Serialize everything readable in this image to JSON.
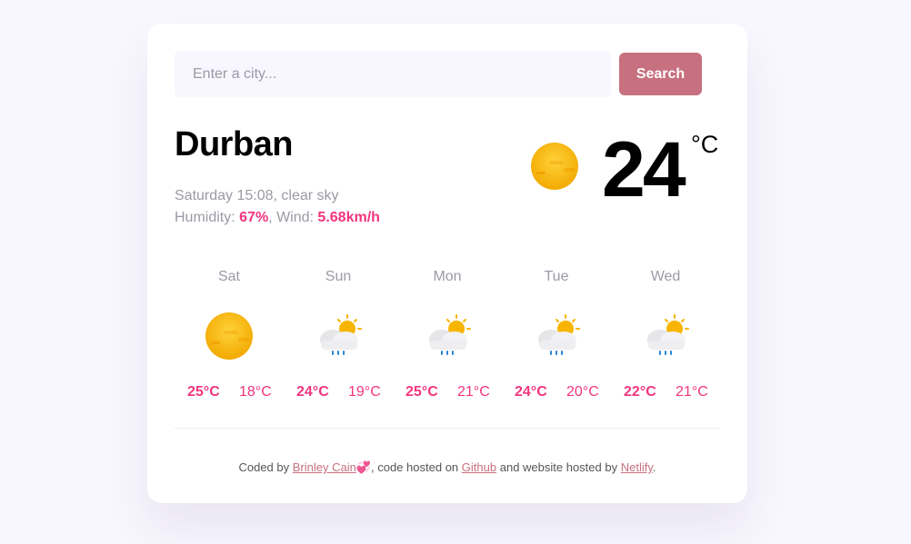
{
  "search": {
    "placeholder": "Enter a city...",
    "value": "",
    "button_label": "Search"
  },
  "current": {
    "city": "Durban",
    "datetime": "Saturday 15:08",
    "description": "clear sky",
    "humidity_label": "Humidity:",
    "humidity": "67%",
    "wind_label": "Wind:",
    "wind": "5.68km/h",
    "temperature": "24",
    "unit": "°C",
    "icon": "clear-sky-icon"
  },
  "forecast": [
    {
      "day": "Sat",
      "max": "25°C",
      "min": "18°C",
      "icon": "clear-sky-icon"
    },
    {
      "day": "Sun",
      "max": "24°C",
      "min": "19°C",
      "icon": "rain-sun-icon"
    },
    {
      "day": "Mon",
      "max": "25°C",
      "min": "21°C",
      "icon": "rain-sun-icon"
    },
    {
      "day": "Tue",
      "max": "24°C",
      "min": "20°C",
      "icon": "rain-sun-icon"
    },
    {
      "day": "Wed",
      "max": "22°C",
      "min": "21°C",
      "icon": "rain-sun-icon"
    }
  ],
  "footer": {
    "coded_by": "Coded by",
    "author": "Brinley Cain",
    "heart": "💞",
    "hosted_on": ", code hosted on",
    "repo_link": "Github",
    "and_website": "and website hosted by",
    "host_link": "Netlify",
    "end": "."
  },
  "colors": {
    "accent": "#f2357e",
    "button": "#c7707f",
    "background": "#f8f6fe",
    "muted_text": "#9a9aa6"
  }
}
